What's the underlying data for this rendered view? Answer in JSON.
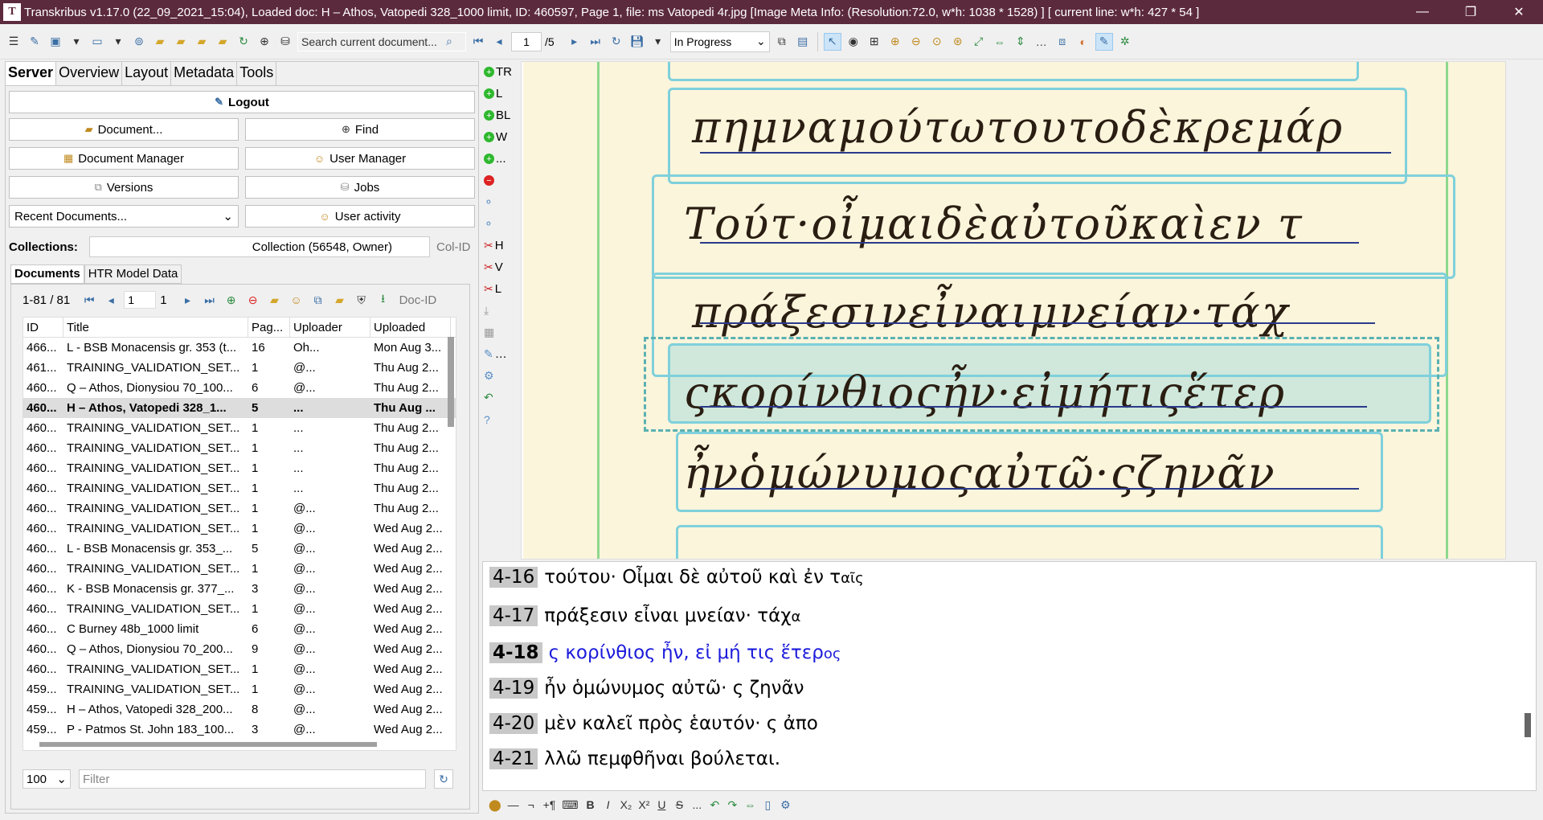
{
  "window": {
    "title": "Transkribus v1.17.0 (22_09_2021_15:04), Loaded doc: H – Athos, Vatopedi 328_1000 limit, ID: 460597, Page 1, file: ms Vatopedi 4r.jpg [Image Meta Info: (Resolution:72.0, w*h: 1038 * 1528) ] [ current line: w*h: 427 * 54 ]",
    "app_icon": "T",
    "minimize": "—",
    "maximize": "❐",
    "close": "✕"
  },
  "toolbar": {
    "search_placeholder": "Search current document...",
    "page_value": "1",
    "page_total": "/5",
    "status_value": "In Progress"
  },
  "left": {
    "tabs": [
      "Server",
      "Overview",
      "Layout",
      "Metadata",
      "Tools"
    ],
    "buttons": {
      "logout": "Logout",
      "document": "Document...",
      "find": "Find",
      "doc_manager": "Document Manager",
      "user_manager": "User Manager",
      "versions": "Versions",
      "jobs": "Jobs",
      "recent": "Recent Documents...",
      "user_activity": "User activity"
    },
    "collections_label": "Collections:",
    "collection_value": "Collection (56548, Owner)",
    "col_id": "Col-ID",
    "subtabs": [
      "Documents",
      "HTR Model Data"
    ],
    "pager_range": "1-81 / 81",
    "pager_from": "1",
    "pager_to": "1",
    "doc_id": "Doc-ID",
    "columns": [
      "ID",
      "Title",
      "Pag...",
      "Uploader",
      "Uploaded"
    ],
    "rows": [
      [
        "466...",
        "L - BSB Monacensis gr. 353 (t...",
        "16",
        "Oh...",
        "Mon Aug 3..."
      ],
      [
        "461...",
        "TRAINING_VALIDATION_SET...",
        "1",
        "@...",
        "Thu Aug 2..."
      ],
      [
        "460...",
        "Q – Athos, Dionysiou 70_100...",
        "6",
        "@...",
        "Thu Aug 2..."
      ],
      [
        "460...",
        "H – Athos, Vatopedi 328_1...",
        "5",
        "...",
        "Thu Aug ..."
      ],
      [
        "460...",
        "TRAINING_VALIDATION_SET...",
        "1",
        "...",
        "Thu Aug 2..."
      ],
      [
        "460...",
        "TRAINING_VALIDATION_SET...",
        "1",
        "...",
        "Thu Aug 2..."
      ],
      [
        "460...",
        "TRAINING_VALIDATION_SET...",
        "1",
        "...",
        "Thu Aug 2..."
      ],
      [
        "460...",
        "TRAINING_VALIDATION_SET...",
        "1",
        "...",
        "Thu Aug 2..."
      ],
      [
        "460...",
        "TRAINING_VALIDATION_SET...",
        "1",
        "@...",
        "Thu Aug 2..."
      ],
      [
        "460...",
        "TRAINING_VALIDATION_SET...",
        "1",
        "@...",
        "Wed Aug 2..."
      ],
      [
        "460...",
        "L - BSB Monacensis gr. 353_...",
        "5",
        "@...",
        "Wed Aug 2..."
      ],
      [
        "460...",
        "TRAINING_VALIDATION_SET...",
        "1",
        "@...",
        "Wed Aug 2..."
      ],
      [
        "460...",
        "K - BSB Monacensis gr. 377_...",
        "3",
        "@...",
        "Wed Aug 2..."
      ],
      [
        "460...",
        "TRAINING_VALIDATION_SET...",
        "1",
        "@...",
        "Wed Aug 2..."
      ],
      [
        "460...",
        "C Burney 48b_1000 limit",
        "6",
        "@...",
        "Wed Aug 2..."
      ],
      [
        "460...",
        "Q – Athos, Dionysiou 70_200...",
        "9",
        "@...",
        "Wed Aug 2..."
      ],
      [
        "460...",
        "TRAINING_VALIDATION_SET...",
        "1",
        "@...",
        "Wed Aug 2..."
      ],
      [
        "459...",
        "TRAINING_VALIDATION_SET...",
        "1",
        "@...",
        "Wed Aug 2..."
      ],
      [
        "459...",
        "H – Athos, Vatopedi 328_200...",
        "8",
        "@...",
        "Wed Aug 2..."
      ],
      [
        "459...",
        "P - Patmos St. John 183_100...",
        "3",
        "@...",
        "Wed Aug 2..."
      ]
    ],
    "page_size": "100",
    "filter_placeholder": "Filter"
  },
  "vstrip": [
    "TR",
    "L",
    "BL",
    "W",
    "...",
    "",
    "",
    "",
    "H",
    "V",
    "L"
  ],
  "manuscript_lines": [
    "πημναμούτωτουτοδὲκρεμάρ",
    "Τούτ·οἶμαιδὲαὐτοῦκαὶεν τ",
    "πράξεσινεἶναιμνείαν·τάχ",
    "ςκορίνθιοςἦν·εἰμήτιςἕτερ",
    "ἦνὁμώνυμοςαὐτῶ·ςζηνᾶν"
  ],
  "editor": {
    "lines": [
      {
        "num": "4-16",
        "text": "τούτου· Οἶμαι δὲ αὐτοῦ καὶ ἐν τ",
        "sup": "αῖς"
      },
      {
        "num": "4-17",
        "text": "πράξεσιν εἶναι μνείαν· τάχ",
        "sup": "α"
      },
      {
        "num": "4-18",
        "text": "ς κορίνθιος ἦν, εἰ μή τις ἕτερ",
        "sup": "ος"
      },
      {
        "num": "4-19",
        "text": "ἦν ὁμώνυμος αὐτῶ· ς ζηνᾶν",
        "sup": ""
      },
      {
        "num": "4-20",
        "text": "μὲν καλεῖ πρὸς ἑαυτόν· ς ἀπο",
        "sup": ""
      },
      {
        "num": "4-21",
        "text": "λλῶ πεμφθῆναι βούλεται.",
        "sup": ""
      }
    ]
  },
  "format_bar": [
    "B",
    "I",
    "X₂",
    "X²",
    "U",
    "S",
    "..."
  ]
}
